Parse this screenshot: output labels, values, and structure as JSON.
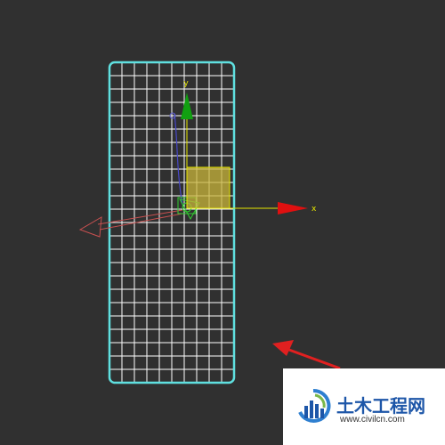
{
  "viewport": {
    "background_color": "#303030",
    "object": {
      "name": "box-wireframe",
      "outline_color": "#5fe0e0",
      "wire_color": "#ffffff",
      "columns": 10,
      "rows": 24
    },
    "gizmo": {
      "x_label": "x",
      "y_label": "y",
      "x_axis_color": "#e01010",
      "y_axis_color": "#11a011",
      "plane_color": "#c8b43a",
      "axis_line_color": "#e6e600"
    },
    "annotation_arrow_color": "#e02020"
  },
  "watermark": {
    "brand": "土木工程网",
    "url": "www.civilcn.com",
    "logo_name": "civilcn-logo"
  }
}
